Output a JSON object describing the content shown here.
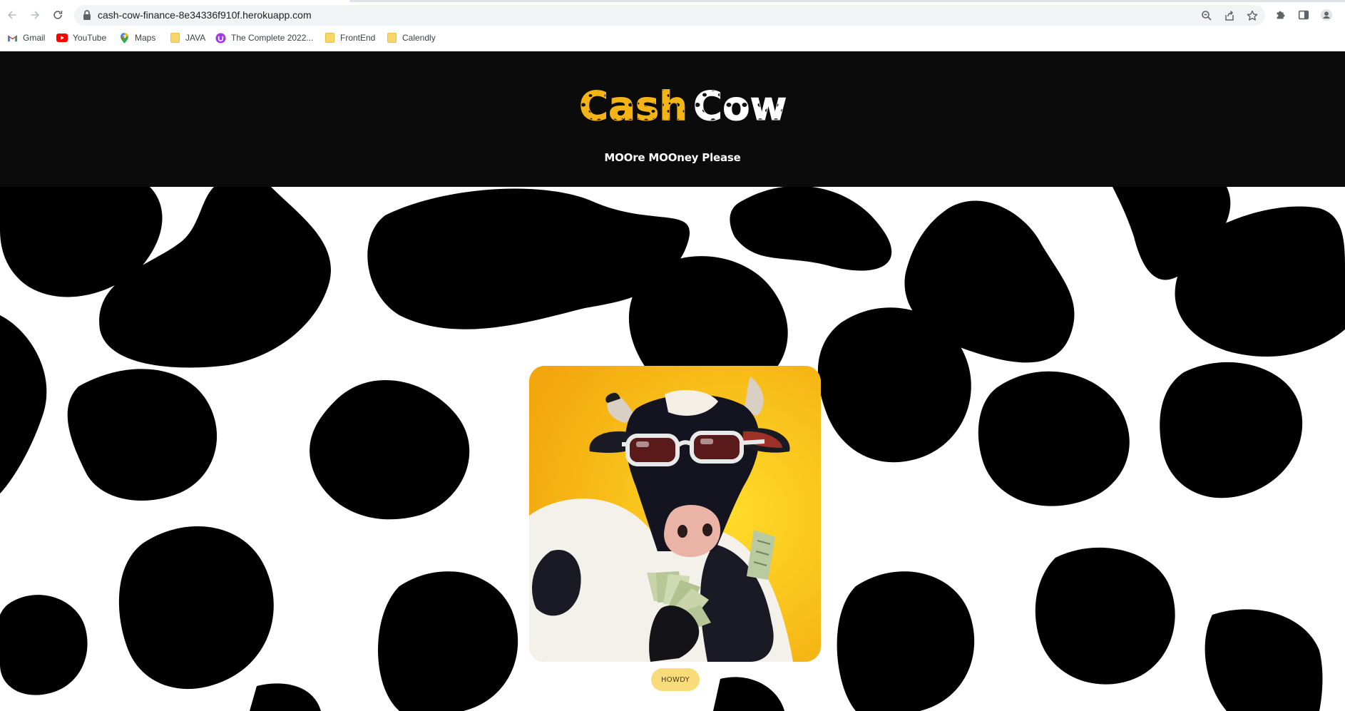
{
  "browser": {
    "url": "cash-cow-finance-8e34336f910f.herokuapp.com",
    "bookmarks": [
      {
        "label": "Gmail",
        "icon": "gmail-icon"
      },
      {
        "label": "YouTube",
        "icon": "youtube-icon"
      },
      {
        "label": "Maps",
        "icon": "maps-icon"
      },
      {
        "label": "JAVA",
        "icon": "folder-icon"
      },
      {
        "label": "The Complete 2022...",
        "icon": "course-icon"
      },
      {
        "label": "FrontEnd",
        "icon": "folder-icon"
      },
      {
        "label": "Calendly",
        "icon": "folder-icon"
      }
    ]
  },
  "header": {
    "logo_word1": "Cash",
    "logo_word2": "Cow",
    "tagline": "MOOre MOOney Please"
  },
  "hero": {
    "image_alt": "cow with sunglasses holding money",
    "button_label": "HOWDY"
  },
  "colors": {
    "header_bg": "#0b0b0b",
    "accent_yellow": "#f8dc7c",
    "logo_yellow": "#f4b416"
  }
}
